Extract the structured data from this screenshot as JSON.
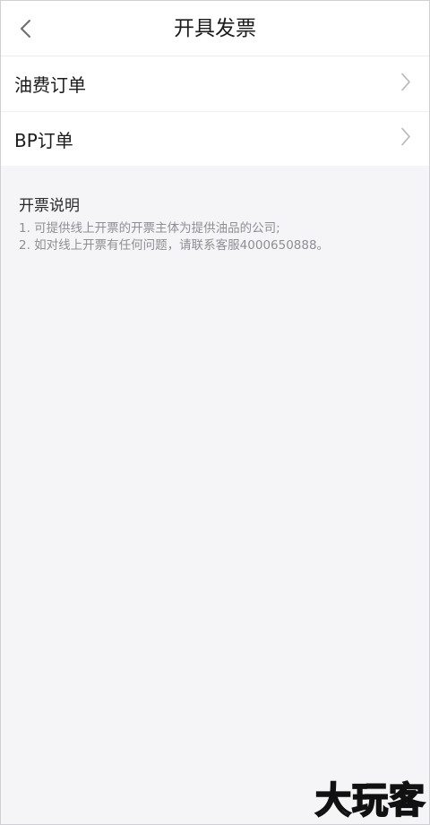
{
  "header": {
    "title": "开具发票",
    "back_icon": "chevron-left-icon"
  },
  "list": {
    "items": [
      {
        "label": "油费订单",
        "icon": "chevron-right-icon"
      },
      {
        "label": "BP订单",
        "icon": "chevron-right-icon"
      }
    ]
  },
  "notes": {
    "title": "开票说明",
    "lines": [
      "1. 可提供线上开票的开票主体为提供油品的公司;",
      "2. 如对线上开票有任何问题，请联系客服4000650888。"
    ]
  },
  "watermark": {
    "text": "大玩客"
  },
  "colors": {
    "background": "#f5f5f7",
    "surface": "#ffffff",
    "text_primary": "#1c1c1e",
    "text_secondary": "#8e8e93",
    "chevron": "#b5b5ba"
  }
}
